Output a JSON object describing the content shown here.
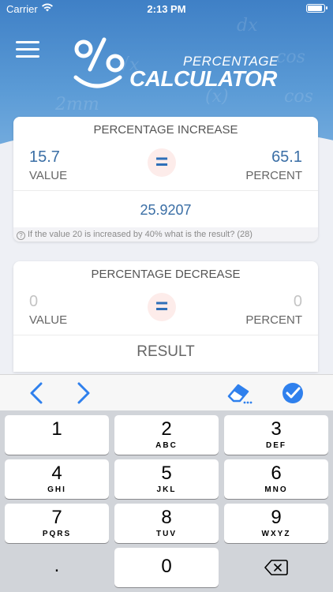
{
  "status_bar": {
    "carrier": "Carrier",
    "time": "2:13 PM"
  },
  "logo": {
    "line1": "PERCENTAGE",
    "line2": "CALCULATOR"
  },
  "increase_card": {
    "title": "PERCENTAGE INCREASE",
    "value": "15.7",
    "value_label": "VALUE",
    "percent": "65.1",
    "percent_label": "PERCENT",
    "equals": "=",
    "result": "25.9207",
    "hint_icon": "?",
    "hint": "If the value 20 is increased by 40% what is the result? (28)"
  },
  "decrease_card": {
    "title": "PERCENTAGE DECREASE",
    "value": "0",
    "value_label": "VALUE",
    "percent": "0",
    "percent_label": "PERCENT",
    "equals": "=",
    "result": "RESULT"
  },
  "keyboard_toolbar": {
    "prev_icon": "chevron-left-icon",
    "next_icon": "chevron-right-icon",
    "erase_icon": "eraser-icon",
    "done_icon": "checkmark-circle-icon",
    "accent": "#2f80ed"
  },
  "keypad": {
    "keys": [
      {
        "num": "1",
        "letters": ""
      },
      {
        "num": "2",
        "letters": "ABC"
      },
      {
        "num": "3",
        "letters": "DEF"
      },
      {
        "num": "4",
        "letters": "GHI"
      },
      {
        "num": "5",
        "letters": "JKL"
      },
      {
        "num": "6",
        "letters": "MNO"
      },
      {
        "num": "7",
        "letters": "PQRS"
      },
      {
        "num": "8",
        "letters": "TUV"
      },
      {
        "num": "9",
        "letters": "WXYZ"
      },
      {
        "num": ".",
        "letters": ""
      },
      {
        "num": "0",
        "letters": ""
      },
      {
        "num": "",
        "letters": ""
      }
    ]
  }
}
